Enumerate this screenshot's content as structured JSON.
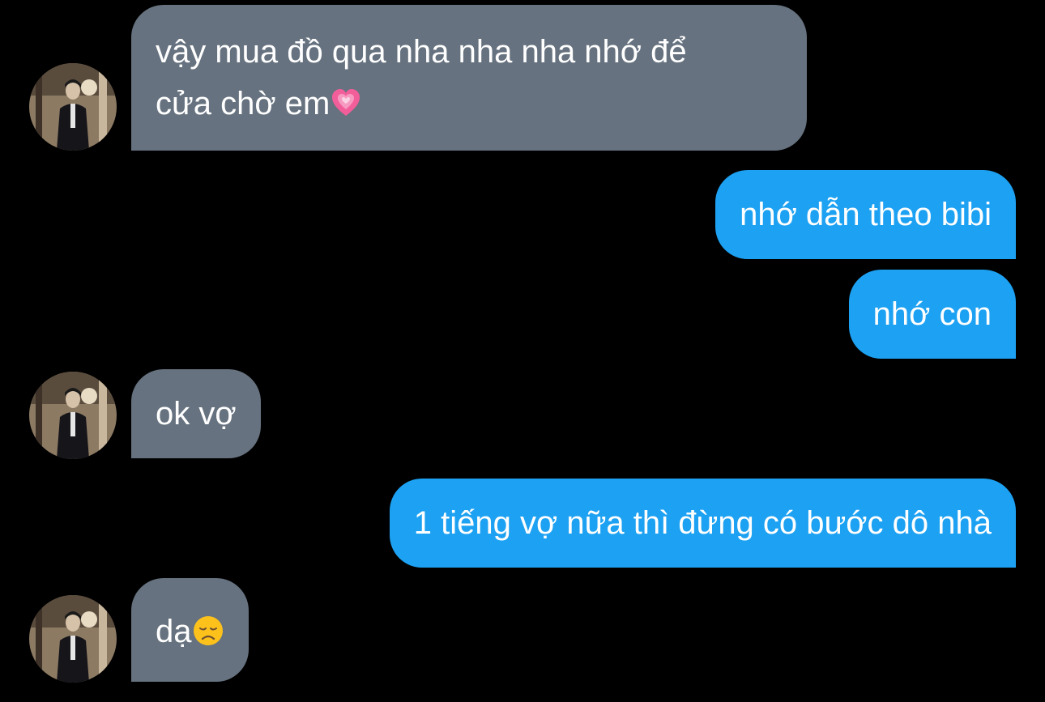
{
  "conversation": {
    "messages": [
      {
        "direction": "incoming",
        "lines": [
          "vậy mua đồ qua nha nha nha nhớ để",
          "cửa chờ em"
        ],
        "emoji": "growing-heart-icon"
      },
      {
        "direction": "outgoing",
        "text": "nhớ dẫn theo bibi"
      },
      {
        "direction": "outgoing",
        "text": "nhớ con"
      },
      {
        "direction": "incoming",
        "text": "ok vợ"
      },
      {
        "direction": "outgoing",
        "text": "1 tiếng vợ nữa thì đừng có bước dô nhà"
      },
      {
        "direction": "incoming",
        "text": "dạ",
        "emoji": "disappointed-face-icon"
      }
    ]
  },
  "colors": {
    "background": "#000000",
    "incoming_bubble": "#66727f",
    "outgoing_bubble": "#1da1f2",
    "text": "#ffffff"
  }
}
